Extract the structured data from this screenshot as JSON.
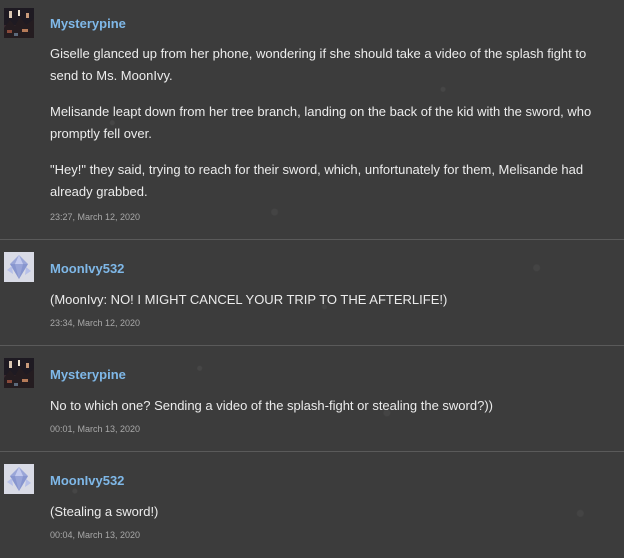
{
  "posts": [
    {
      "author": "Mysterypine",
      "avatar_icon": "landscape-avatar-icon",
      "paragraphs": [
        "Giselle glanced up from her phone, wondering if she should take a video of the splash fight to send to Ms. MoonIvy.",
        "Melisande leapt down from her tree branch, landing on the back of the kid with the sword, who promptly fell over.",
        "\"Hey!\" they said, trying to reach for their sword, which, unfortunately for them, Melisande had already grabbed."
      ],
      "timestamp": "23:27, March 12, 2020"
    },
    {
      "author": "MoonIvy532",
      "avatar_icon": "crystal-avatar-icon",
      "paragraphs": [
        "(MoonIvy: NO! I MIGHT CANCEL YOUR TRIP TO THE AFTERLIFE!)"
      ],
      "timestamp": "23:34, March 12, 2020"
    },
    {
      "author": "Mysterypine",
      "avatar_icon": "landscape-avatar-icon",
      "paragraphs": [
        "No to which one? Sending a video of the splash-fight or stealing the sword?))"
      ],
      "timestamp": "00:01, March 13, 2020"
    },
    {
      "author": "MoonIvy532",
      "avatar_icon": "crystal-avatar-icon",
      "paragraphs": [
        "(Stealing a sword!)"
      ],
      "timestamp": "00:04, March 13, 2020"
    }
  ],
  "colors": {
    "background": "#3c3c3c",
    "author": "#7fb8e8",
    "text": "#ececec",
    "timestamp": "#a8a8a8",
    "divider": "#5a5a5a"
  }
}
